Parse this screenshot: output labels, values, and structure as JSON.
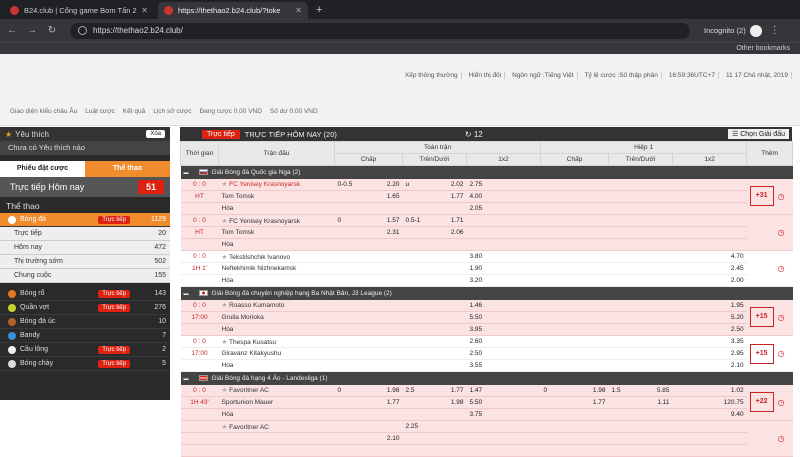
{
  "browser": {
    "tabs": [
      {
        "title": "B24.club | Cổng game Bom Tấn 2"
      },
      {
        "title": "https://thethao2.b24.club/?toke"
      }
    ],
    "new_tab": "+",
    "address": "https://thethao2.b24.club/",
    "profile": "Incognito (2)",
    "other_bookmarks": "Other bookmarks"
  },
  "prefs": [
    "Xếp thông thường",
    "Hiển thị đôi",
    "Ngôn ngữ :Tiếng Việt",
    "Tỷ lệ cược :Số thập phân",
    "16:59:36UTC+7",
    "11 17 Chủ nhật, 2019"
  ],
  "subnav": [
    "Giao diện kiểu châu Âu",
    "Luật cược",
    "Kết quả",
    "Lịch sử cược",
    "Đang cược 0.00 VND",
    "Số dư 0.00 VND"
  ],
  "sidebar": {
    "fav_title": "Yêu thích",
    "close_label": "Xóa",
    "no_fav": "Chưa có Yêu thích nào",
    "tab_slip": "Phiếu đặt cược",
    "tab_sport": "Thể thao",
    "live_today": "Trực tiếp Hôm nay",
    "live_count": "51",
    "section": "Thể thao",
    "football": {
      "label": "Bóng đá",
      "live": "Trực tiếp",
      "count": "1129"
    },
    "sub": [
      {
        "label": "Trực tiếp",
        "count": "20"
      },
      {
        "label": "Hôm nay",
        "count": "472"
      },
      {
        "label": "Thị trường sớm",
        "count": "502"
      },
      {
        "label": "Chung cuộc",
        "count": "155"
      }
    ],
    "sports": [
      {
        "label": "Bóng rổ",
        "live": "Trực tiếp",
        "count": "143",
        "color": "#e8761e"
      },
      {
        "label": "Quần vợt",
        "live": "Trực tiếp",
        "count": "276",
        "color": "#c6d32a"
      },
      {
        "label": "Bóng đá úc",
        "live": "",
        "count": "10",
        "color": "#b5612a"
      },
      {
        "label": "Bandy",
        "live": "",
        "count": "7",
        "color": "#3a8fd8"
      },
      {
        "label": "Cầu lông",
        "live": "Trực tiếp",
        "count": "2",
        "color": "#eeeeee"
      },
      {
        "label": "Bóng chày",
        "live": "Trực tiếp",
        "count": "5",
        "color": "#dddddd"
      }
    ]
  },
  "main": {
    "live_label": "Trực tiếp",
    "title": "TRỰC TIẾP HÔM NAY (20)",
    "refresh": "12",
    "pick_league": "Chọn Giải đấu",
    "headers": {
      "time": "Thời gian",
      "match": "Trận đấu",
      "full": "Toàn trận",
      "half": "Hiệp 1",
      "handicap": "Chấp",
      "overunder": "Trên/Dưới",
      "x12": "1x2",
      "more": "Thêm"
    },
    "leagues": [
      {
        "name": "Giải Bóng đá Quốc gia Nga (2)",
        "flag": "ru",
        "matches": [
          {
            "score": "0 : 0",
            "time": "HT",
            "home": "FC Yenisey Krasnoyarsk",
            "away": "Tom Tomsk",
            "draw": "Hòa",
            "home_red": true,
            "h_line": "0-0.5",
            "h1": "2.20",
            "h2": "1.65",
            "ou_line": "u",
            "ou1": "2.02",
            "ou2": "1.77",
            "x1": "2.75",
            "x2": "4.00",
            "x3": "2.05",
            "hh_line": "",
            "hh1": "",
            "hh2": "",
            "hou_line": "",
            "hou1": "",
            "hou2": "",
            "hx1": "",
            "hx2": "",
            "hx3": "",
            "more": "+31",
            "bg": "m1"
          },
          {
            "score": "0 : 0",
            "time": "HT",
            "home": "FC Yenisey Krasnoyarsk",
            "away": "Tom Tomsk",
            "draw": "Hòa",
            "home_red": false,
            "h_line": "0",
            "h1": "1.57",
            "h2": "2.31",
            "ou_line": "0.5-1",
            "ou1": "1.71",
            "ou2": "2.06",
            "x1": "",
            "x2": "",
            "x3": "",
            "hh_line": "",
            "hh1": "",
            "hh2": "",
            "hou_line": "",
            "hou1": "",
            "hou2": "",
            "hx1": "",
            "hx2": "",
            "hx3": "",
            "more": "",
            "bg": "m1"
          },
          {
            "score": "0 : 0",
            "time": "1H 1'",
            "home": "Tekstilshchik Ivanovo",
            "away": "Neftekhimik Nizhnekamsk",
            "draw": "Hòa",
            "home_red": false,
            "h_line": "",
            "h1": "",
            "h2": "",
            "ou_line": "",
            "ou1": "",
            "ou2": "",
            "x1": "3.80",
            "x2": "1.90",
            "x3": "3.20",
            "hh_line": "",
            "hh1": "",
            "hh2": "",
            "hou_line": "",
            "hou1": "",
            "hou2": "",
            "hx1": "4.70",
            "hx2": "2.45",
            "hx3": "2.00",
            "more": "",
            "bg": "m2"
          }
        ]
      },
      {
        "name": "Giải Bóng đá chuyên nghiệp hạng Ba Nhật Bản, J3 League (2)",
        "flag": "jp",
        "matches": [
          {
            "score": "0 : 0",
            "time": "17:00",
            "home": "Roasso Kumamoto",
            "away": "Grulla Morioka",
            "draw": "Hòa",
            "home_red": false,
            "h_line": "",
            "h1": "",
            "h2": "",
            "ou_line": "",
            "ou1": "",
            "ou2": "",
            "x1": "1.46",
            "x2": "5.50",
            "x3": "3.95",
            "hh_line": "",
            "hh1": "",
            "hh2": "",
            "hou_line": "",
            "hou1": "",
            "hou2": "",
            "hx1": "1.95",
            "hx2": "5.20",
            "hx3": "2.50",
            "more": "+15",
            "bg": "m1"
          },
          {
            "score": "0 : 0",
            "time": "17:00",
            "home": "Thespa Kusatsu",
            "away": "Giravanz Kitakyushu",
            "draw": "Hòa",
            "home_red": false,
            "h_line": "",
            "h1": "",
            "h2": "",
            "ou_line": "",
            "ou1": "",
            "ou2": "",
            "x1": "2.60",
            "x2": "2.50",
            "x3": "3.55",
            "hh_line": "",
            "hh1": "",
            "hh2": "",
            "hou_line": "",
            "hou1": "",
            "hou2": "",
            "hx1": "3.35",
            "hx2": "2.95",
            "hx3": "2.10",
            "more": "+15",
            "bg": "m2"
          }
        ]
      },
      {
        "name": "Giải Bóng đá hạng 4 Áo - Landesliga (1)",
        "flag": "at",
        "matches": [
          {
            "score": "0 : 0",
            "time": "1H 43'",
            "home": "Favoritner AC",
            "away": "Sportunion Mauer",
            "draw": "Hòa",
            "home_red": false,
            "h_line": "0",
            "h1": "1.98",
            "h2": "1.77",
            "ou_line": "2.5",
            "ou1": "1.77",
            "ou2": "1.98",
            "x1": "1.47",
            "x2": "5.50",
            "x3": "3.75",
            "hh_line": "0",
            "hh1": "1.98",
            "hh2": "1.77",
            "hou_line": "1.5",
            "hou1": "5.85",
            "hou2": "1.11",
            "hx1": "1.02",
            "hx2": "120.75",
            "hx3": "9.40",
            "more": "+22",
            "bg": "m1"
          },
          {
            "score": "",
            "time": "",
            "home": "Favoritner AC",
            "away": "",
            "draw": "",
            "home_red": false,
            "h_line": "",
            "h1": "",
            "h2": "2.10",
            "ou_line": "2.25",
            "ou1": "",
            "ou2": "",
            "x1": "",
            "x2": "",
            "x3": "",
            "hh_line": "",
            "hh1": "",
            "hh2": "",
            "hou_line": "",
            "hou1": "",
            "hou2": "",
            "hx1": "",
            "hx2": "",
            "hx3": "",
            "more": "",
            "bg": "m1"
          }
        ]
      }
    ]
  }
}
